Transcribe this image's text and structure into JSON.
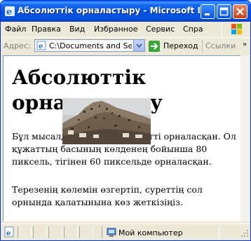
{
  "window": {
    "title": "Абсолюттік орналастыру - Microsoft I..."
  },
  "menubar": {
    "items": [
      "Файл",
      "Правка",
      "Вид",
      "Избранное",
      "Сервис",
      "Спра"
    ]
  },
  "address": {
    "label": "Адрес:",
    "value": "C:\\Documents and Setti",
    "go_label": "Переход",
    "links_label": "Ссылки",
    "links_chevron": "»"
  },
  "page": {
    "heading": "Абсолюттік орналастыру",
    "paragraph1": "Бұл мысалдағы сурет абсолютті орналасқан. Ол құжаттың басының көлденең бойынша 80 пиксель, тігінен 60 пиксельде орналасқан.",
    "paragraph2": "Терезенің көлемін өзгертіп, суреттің сол орнында қалатынына көз жеткізіңіз."
  },
  "status": {
    "zone_text": "Мой компьютер"
  },
  "icons": {
    "app": "ie-icon",
    "minimize": "minimize-icon",
    "maximize": "maximize-icon",
    "close": "close-icon",
    "go": "go-arrow-icon",
    "zone": "computer-icon"
  },
  "colors": {
    "titlebar": "#0054e3",
    "chrome": "#ece9d8",
    "content_bg": "#ffffff"
  }
}
